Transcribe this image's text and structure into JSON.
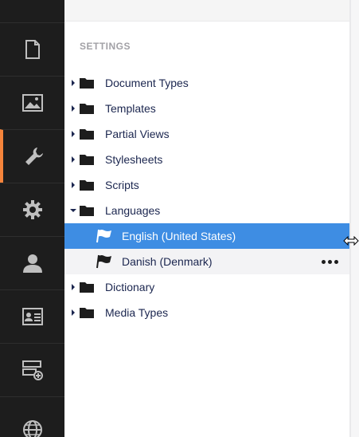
{
  "rail": {
    "items": [
      {
        "icon": "document-icon",
        "active": false
      },
      {
        "icon": "image-icon",
        "active": false
      },
      {
        "icon": "wrench-icon",
        "active": true
      },
      {
        "icon": "gear-icon",
        "active": false
      },
      {
        "icon": "user-icon",
        "active": false
      },
      {
        "icon": "id-card-icon",
        "active": false
      },
      {
        "icon": "forms-icon",
        "active": false
      },
      {
        "icon": "globe-icon",
        "active": false
      }
    ],
    "accent_color": "#f5843b"
  },
  "tree": {
    "section_title": "SETTINGS",
    "items": [
      {
        "label": "Document Types",
        "expanded": false
      },
      {
        "label": "Templates",
        "expanded": false
      },
      {
        "label": "Partial Views",
        "expanded": false
      },
      {
        "label": "Stylesheets",
        "expanded": false
      },
      {
        "label": "Scripts",
        "expanded": false
      },
      {
        "label": "Languages",
        "expanded": true
      },
      {
        "label": "Dictionary",
        "expanded": false
      },
      {
        "label": "Media Types",
        "expanded": false
      }
    ],
    "languages_children": [
      {
        "label": "English (United States)",
        "selected": true
      },
      {
        "label": "Danish (Denmark)",
        "selected": false,
        "actions_visible": true
      }
    ],
    "selected_color": "#3e8de3"
  }
}
